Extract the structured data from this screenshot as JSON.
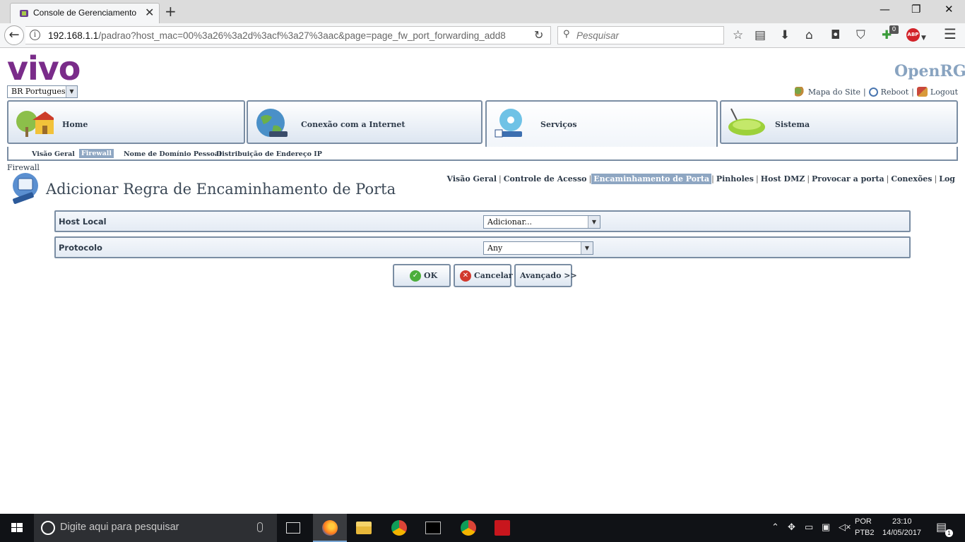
{
  "browser": {
    "tab_title": "Console de Gerenciamento",
    "url_host": "192.168.1.1",
    "url_path": "/padrao?host_mac=00%3a26%3a2d%3acf%3a27%3aac&page=page_fw_port_forwarding_add8",
    "search_placeholder": "Pesquisar",
    "notification_badge": "0",
    "abp_label": "ABP"
  },
  "header": {
    "logo_text": "vivo",
    "brand_text": "OpenRG",
    "language": "BR Portuguese",
    "links": {
      "sitemap": "Mapa do Site",
      "reboot": "Reboot",
      "logout": "Logout"
    }
  },
  "main_tabs": [
    {
      "label": "Home"
    },
    {
      "label": "Conexão com a Internet"
    },
    {
      "label": "Serviços"
    },
    {
      "label": "Sistema"
    }
  ],
  "sub_tabs": [
    {
      "label": "Visão Geral"
    },
    {
      "label": "Firewall"
    },
    {
      "label": "Nome de Domínio Pessoal"
    },
    {
      "label": "Distribuição de Endereço IP"
    }
  ],
  "breadcrumb": "Firewall",
  "page_title": "Adicionar Regra de Encaminhamento de Porta",
  "right_nav": [
    {
      "label": "Visão Geral"
    },
    {
      "label": "Controle de Acesso"
    },
    {
      "label": "Encaminhamento de Porta"
    },
    {
      "label": "Pinholes"
    },
    {
      "label": "Host DMZ"
    },
    {
      "label": "Provocar a porta"
    },
    {
      "label": "Conexões"
    },
    {
      "label": "Log"
    }
  ],
  "form": {
    "host_local_label": "Host Local",
    "host_local_value": "Adicionar...",
    "protocol_label": "Protocolo",
    "protocol_value": "Any"
  },
  "buttons": {
    "ok": "OK",
    "cancel": "Cancelar",
    "advanced": "Avançado >>"
  },
  "taskbar": {
    "search_placeholder": "Digite aqui para pesquisar",
    "lang_line1": "POR",
    "lang_line2": "PTB2",
    "time": "23:10",
    "date": "14/05/2017",
    "notification_count": "1"
  },
  "colors": {
    "vivo_purple": "#7a2c8a",
    "frame_blue": "#7a8da3",
    "active_highlight": "#8ea6c2"
  }
}
